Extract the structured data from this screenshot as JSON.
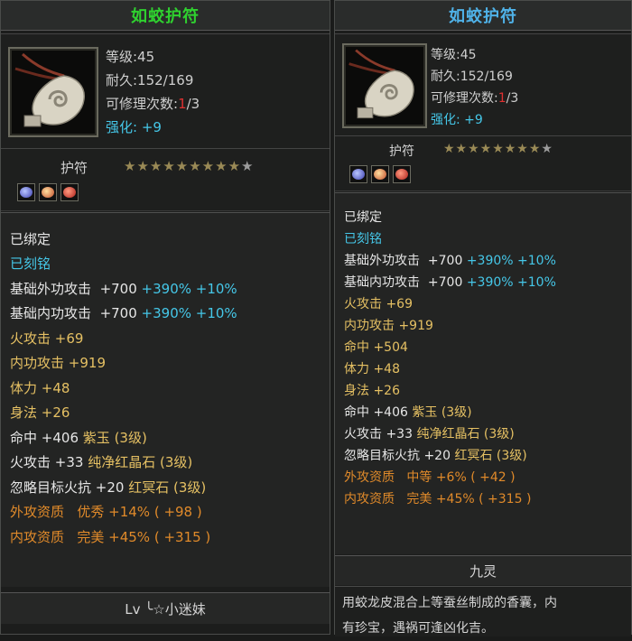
{
  "left": {
    "title": "如蛟护符",
    "level": "等级:45",
    "durability": "耐久:152/169",
    "repair_prefix": "可修理次数:",
    "repair_used": "1",
    "repair_total": "/3",
    "enhance_label": "强化:",
    "enhance_value": "+9",
    "category": "护符",
    "stars_filled": "★★★★★★★★★",
    "stars_empty": "★",
    "bound": "已绑定",
    "engraved": "已刻铭",
    "attrs": [
      {
        "label": "基础外功攻击",
        "value": "+700",
        "extra1": "+390%",
        "extra2": "+10%"
      },
      {
        "label": "基础内功攻击",
        "value": "+700",
        "extra1": "+390%",
        "extra2": "+10%"
      },
      {
        "label": "火攻击",
        "value": "+69"
      },
      {
        "label": "内功攻击",
        "value": "+919"
      },
      {
        "label": "体力",
        "value": "+48"
      },
      {
        "label": "身法",
        "value": "+26"
      },
      {
        "label": "命中",
        "value": "+406",
        "gem": "紫玉",
        "gem_level": "(3级)"
      },
      {
        "label": "火攻击",
        "value": "+33",
        "gem": "纯净红晶石",
        "gem_level": "(3级)"
      },
      {
        "label": "忽略目标火抗",
        "value": "+20",
        "gem": "红冥石",
        "gem_level": "(3级)"
      },
      {
        "label": "外攻资质",
        "grade": "优秀",
        "pct": "+14%",
        "num": "( +98 )"
      },
      {
        "label": "内攻资质",
        "grade": "完美",
        "pct": "+45%",
        "num": "( +315 )"
      }
    ],
    "owner": "Lv ╰☆小迷妹"
  },
  "right": {
    "title": "如蛟护符",
    "level": "等级:45",
    "durability": "耐久:152/169",
    "repair_prefix": "可修理次数:",
    "repair_used": "1",
    "repair_total": "/3",
    "enhance_label": "强化:",
    "enhance_value": "+9",
    "category": "护符",
    "stars_filled": "★★★★★★★★",
    "stars_empty": "★",
    "bound": "已绑定",
    "engraved": "已刻铭",
    "attrs": [
      {
        "label": "基础外功攻击",
        "value": "+700",
        "extra1": "+390%",
        "extra2": "+10%"
      },
      {
        "label": "基础内功攻击",
        "value": "+700",
        "extra1": "+390%",
        "extra2": "+10%"
      },
      {
        "label": "火攻击",
        "value": "+69"
      },
      {
        "label": "内功攻击",
        "value": "+919"
      },
      {
        "label": "命中",
        "value": "+504"
      },
      {
        "label": "体力",
        "value": "+48"
      },
      {
        "label": "身法",
        "value": "+26"
      },
      {
        "label": "命中",
        "value": "+406",
        "gem": "紫玉",
        "gem_level": "(3级)"
      },
      {
        "label": "火攻击",
        "value": "+33",
        "gem": "纯净红晶石",
        "gem_level": "(3级)"
      },
      {
        "label": "忽略目标火抗",
        "value": "+20",
        "gem": "红冥石",
        "gem_level": "(3级)"
      },
      {
        "label": "外攻资质",
        "grade": "中等",
        "pct": "+6%",
        "num": "( +42 )"
      },
      {
        "label": "内攻资质",
        "grade": "完美",
        "pct": "+45%",
        "num": "( +315 )"
      }
    ],
    "set_name": "九灵",
    "description_line1": "用蛟龙皮混合上等蚕丝制成的香囊，内",
    "description_line2": "有珍宝，遇祸可逢凶化吉。"
  },
  "colors": {
    "title_left": "#2fd12f",
    "title_right": "#4fb2e8",
    "blue_text": "#45c7e8",
    "gold_text": "#e5c063",
    "orange_text": "#e08a2a"
  }
}
